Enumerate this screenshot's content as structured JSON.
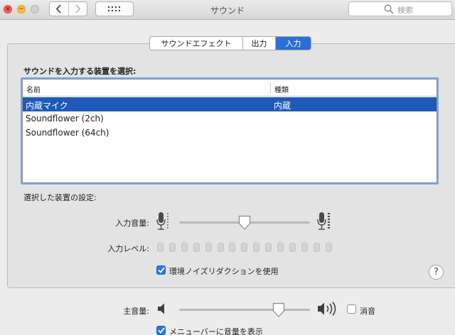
{
  "window": {
    "title": "サウンド"
  },
  "search": {
    "placeholder": "検索"
  },
  "tabs": [
    {
      "label": "サウンドエフェクト",
      "selected": false
    },
    {
      "label": "出力",
      "selected": false
    },
    {
      "label": "入力",
      "selected": true
    }
  ],
  "input_panel": {
    "heading": "サウンドを入力する装置を選択:",
    "columns": {
      "name": "名前",
      "type": "種類"
    },
    "devices": [
      {
        "name": "内蔵マイク",
        "type": "内蔵",
        "selected": true
      },
      {
        "name": "Soundflower (2ch)",
        "type": "",
        "selected": false
      },
      {
        "name": "Soundflower (64ch)",
        "type": "",
        "selected": false
      }
    ],
    "settings_heading": "選択した装置の設定:",
    "input_volume_label": "入力音量:",
    "input_volume_fraction": 0.5,
    "input_level_label": "入力レベル:",
    "input_level_segments": 15,
    "input_level_lit": 0,
    "noise_reduction_label": "環境ノイズリダクションを使用",
    "noise_reduction_checked": true,
    "help_glyph": "?"
  },
  "output_controls": {
    "master_volume_label": "主音量:",
    "master_volume_fraction": 0.76,
    "mute_label": "消音",
    "mute_checked": false,
    "show_in_menubar_label": "メニューバーに音量を表示",
    "show_in_menubar_checked": true
  },
  "icons": {
    "close": "close-icon",
    "minimize": "minimize-icon",
    "back": "chevron-left-icon",
    "forward": "chevron-right-icon",
    "grid": "grid-icon",
    "search": "search-icon",
    "mic_low": "microphone-low-icon",
    "mic_high": "microphone-high-icon",
    "speaker_low": "speaker-low-icon",
    "speaker_high": "speaker-high-icon",
    "checkmark": "checkmark-icon"
  },
  "colors": {
    "accent": "#2c6ed6",
    "selection": "#1f5ab6",
    "close": "#fc605c",
    "minimize": "#fdbc40"
  }
}
